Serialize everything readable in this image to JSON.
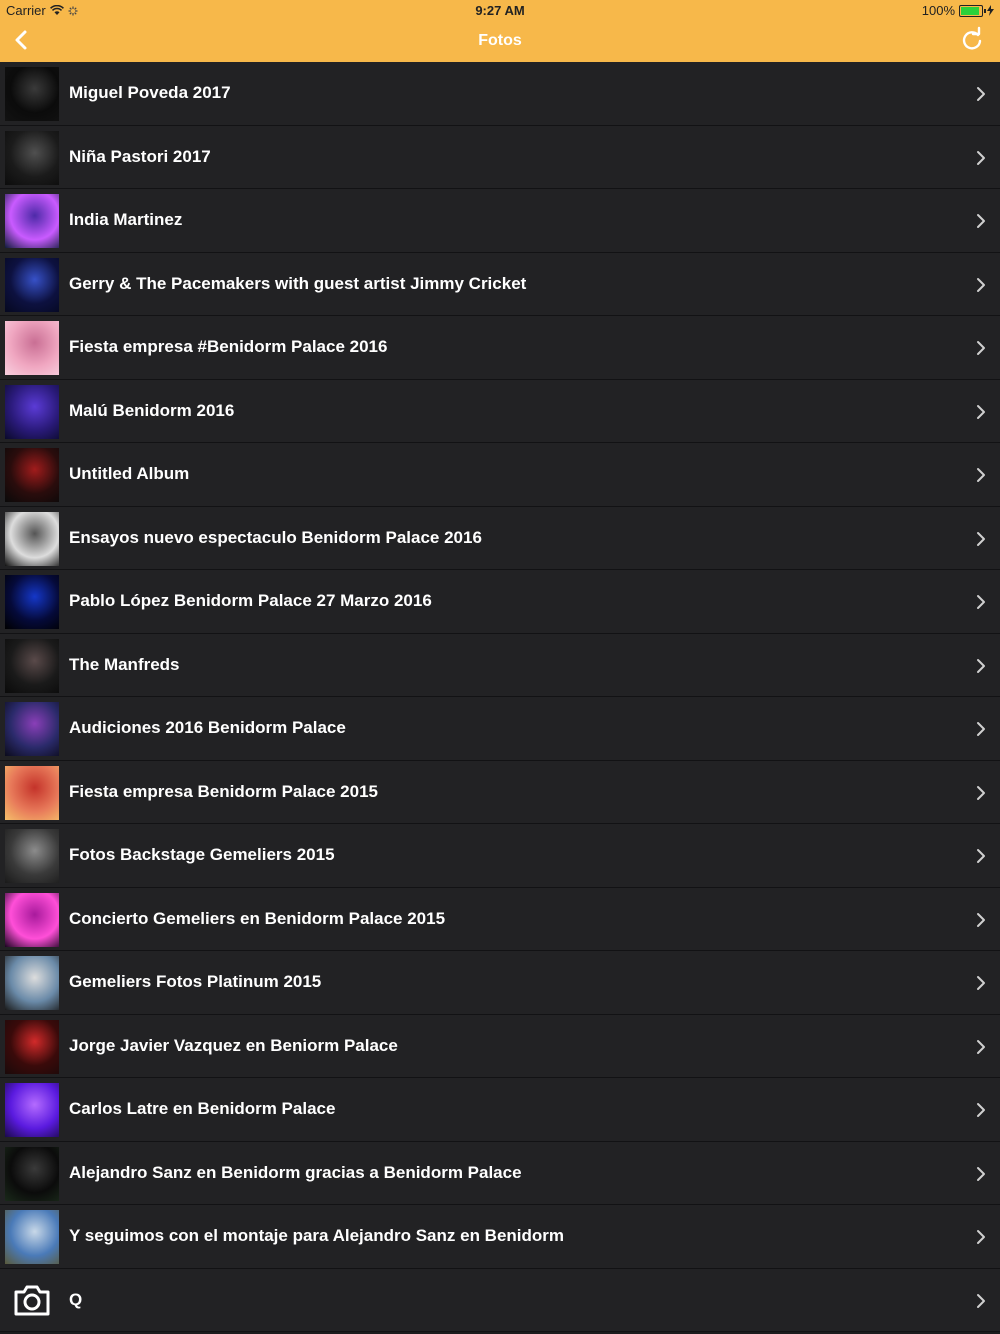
{
  "status_bar": {
    "carrier": "Carrier",
    "time": "9:27 AM",
    "battery": "100%",
    "battery_level": 1.0
  },
  "nav": {
    "title": "Fotos",
    "back_icon": "chevron-left-icon",
    "refresh_icon": "refresh-icon"
  },
  "colors": {
    "header": "#f7b84a",
    "row_bg": "#222224",
    "text": "#ffffff"
  },
  "albums": [
    {
      "title": "Miguel Poveda 2017",
      "thumb": [
        "#0b0b0b",
        "#3a3a3a",
        "#121212"
      ]
    },
    {
      "title": "Niña Pastori 2017",
      "thumb": [
        "#1b1b1b",
        "#505050",
        "#0c0c0c"
      ]
    },
    {
      "title": "India Martinez",
      "thumb": [
        "#c95bff",
        "#4d2aa8",
        "#0f1c3a"
      ]
    },
    {
      "title": "Gerry & The Pacemakers with guest artist Jimmy Cricket",
      "thumb": [
        "#0d1140",
        "#3751c8",
        "#05081f"
      ]
    },
    {
      "title": "Fiesta empresa #Benidorm Palace 2016",
      "thumb": [
        "#f0a7c1",
        "#c96f94",
        "#f8d0df"
      ]
    },
    {
      "title": "Malú Benidorm 2016",
      "thumb": [
        "#2a1a7a",
        "#5b3bd6",
        "#0a0a2a"
      ]
    },
    {
      "title": "Untitled Album",
      "thumb": [
        "#2a0c0c",
        "#a11c1c",
        "#090909"
      ]
    },
    {
      "title": "Ensayos nuevo espectaculo Benidorm Palace 2016",
      "thumb": [
        "#dddddd",
        "#555555",
        "#111111"
      ]
    },
    {
      "title": "Pablo López Benidorm Palace 27 Marzo 2016",
      "thumb": [
        "#050a3a",
        "#1537c8",
        "#000000"
      ]
    },
    {
      "title": "The Manfreds",
      "thumb": [
        "#1a1a1a",
        "#5a4a4a",
        "#0a0a0a"
      ]
    },
    {
      "title": "Audiciones 2016 Benidorm Palace",
      "thumb": [
        "#2a2a6a",
        "#8a3fb8",
        "#0b0b1b"
      ]
    },
    {
      "title": "Fiesta empresa Benidorm Palace 2015",
      "thumb": [
        "#e87a5a",
        "#c4332a",
        "#f5c06a"
      ]
    },
    {
      "title": "Fotos Backstage Gemeliers 2015",
      "thumb": [
        "#3a3a3a",
        "#8c8c8c",
        "#1a1a1a"
      ]
    },
    {
      "title": "Concierto Gemeliers en Benidorm Palace 2015",
      "thumb": [
        "#ff4fd8",
        "#a81a9c",
        "#1a0420"
      ]
    },
    {
      "title": "Gemeliers Fotos Platinum 2015",
      "thumb": [
        "#6a8aa8",
        "#dddddd",
        "#1a1a1a"
      ]
    },
    {
      "title": "Jorge Javier Vazquez en Beniorm Palace",
      "thumb": [
        "#3a0a0a",
        "#d22a2a",
        "#1a0a0a"
      ]
    },
    {
      "title": "Carlos Latre en Benidorm Palace",
      "thumb": [
        "#5a1adf",
        "#b46bff",
        "#1a0a4a"
      ]
    },
    {
      "title": "Alejandro Sanz en Benidorm gracias a Benidorm Palace",
      "thumb": [
        "#0b0b0b",
        "#3a3a3a",
        "#1a2a1a"
      ]
    },
    {
      "title": "Y seguimos con el montaje para Alejandro Sanz en Benidorm",
      "thumb": [
        "#4a7ab8",
        "#c8d8e8",
        "#5a5a3a"
      ]
    },
    {
      "title": "Q",
      "thumb": "camera-icon"
    }
  ]
}
